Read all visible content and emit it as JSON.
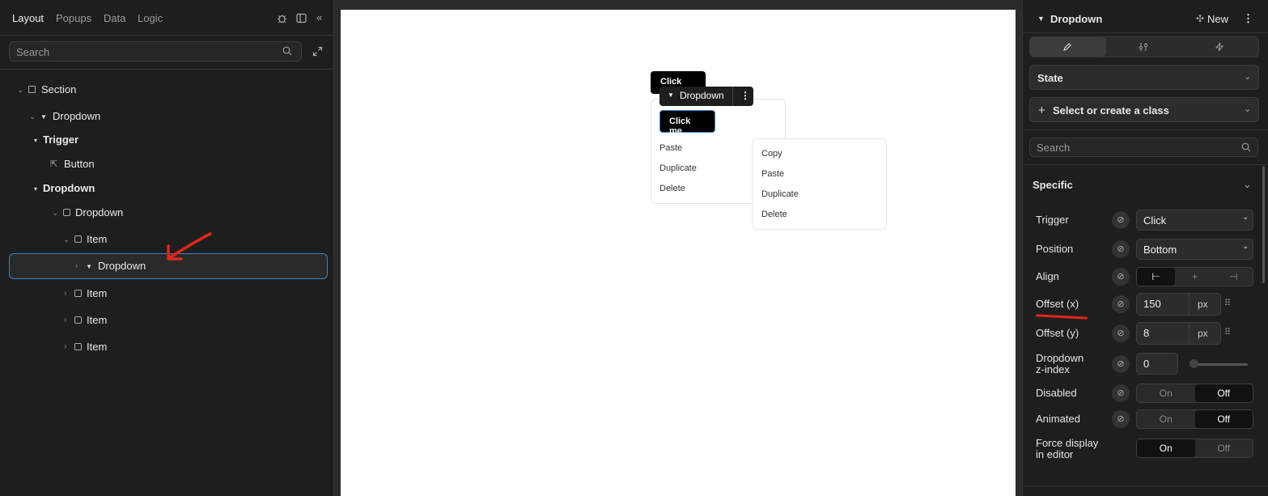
{
  "left_panel": {
    "tabs": [
      {
        "label": "Layout",
        "active": true
      },
      {
        "label": "Popups"
      },
      {
        "label": "Data"
      },
      {
        "label": "Logic"
      }
    ],
    "search": {
      "placeholder": "Search"
    },
    "tree": [
      {
        "label": "Section",
        "bold": false
      },
      {
        "label": "Dropdown"
      },
      {
        "label": "Trigger"
      },
      {
        "label": "Button"
      },
      {
        "label": "Dropdown"
      },
      {
        "label": "Dropdown"
      },
      {
        "label": "Item"
      },
      {
        "label": "Dropdown",
        "selected": true
      },
      {
        "label": "Item"
      },
      {
        "label": "Item"
      },
      {
        "label": "Item"
      }
    ]
  },
  "canvas": {
    "button_top": "Click me",
    "toolbar_label": "Dropdown",
    "inner_button": "Click me",
    "menu1": [
      "Paste",
      "Duplicate",
      "Delete"
    ],
    "menu2": [
      "Copy",
      "Paste",
      "Duplicate",
      "Delete"
    ]
  },
  "right_panel": {
    "title": "Dropdown",
    "new_label": "New",
    "state_label": "State",
    "class_label": "Select or create a class",
    "search_placeholder": "Search",
    "section_title": "Specific",
    "props": {
      "trigger": {
        "label": "Trigger",
        "value": "Click"
      },
      "position": {
        "label": "Position",
        "value": "Bottom"
      },
      "align": {
        "label": "Align"
      },
      "offset_x": {
        "label": "Offset (x)",
        "value": "150",
        "unit": "px"
      },
      "offset_y": {
        "label": "Offset (y)",
        "value": "8",
        "unit": "px"
      },
      "zindex": {
        "label_1": "Dropdown",
        "label_2": "z-index",
        "value": "0"
      },
      "disabled": {
        "label": "Disabled",
        "on": "On",
        "off": "Off"
      },
      "animated": {
        "label": "Animated",
        "on": "On",
        "off": "Off"
      },
      "force": {
        "label_1": "Force display",
        "label_2": "in editor",
        "on": "On",
        "off": "Off"
      }
    }
  },
  "colors": {
    "accent": "#3b82c4",
    "annotation": "#e0271b"
  }
}
